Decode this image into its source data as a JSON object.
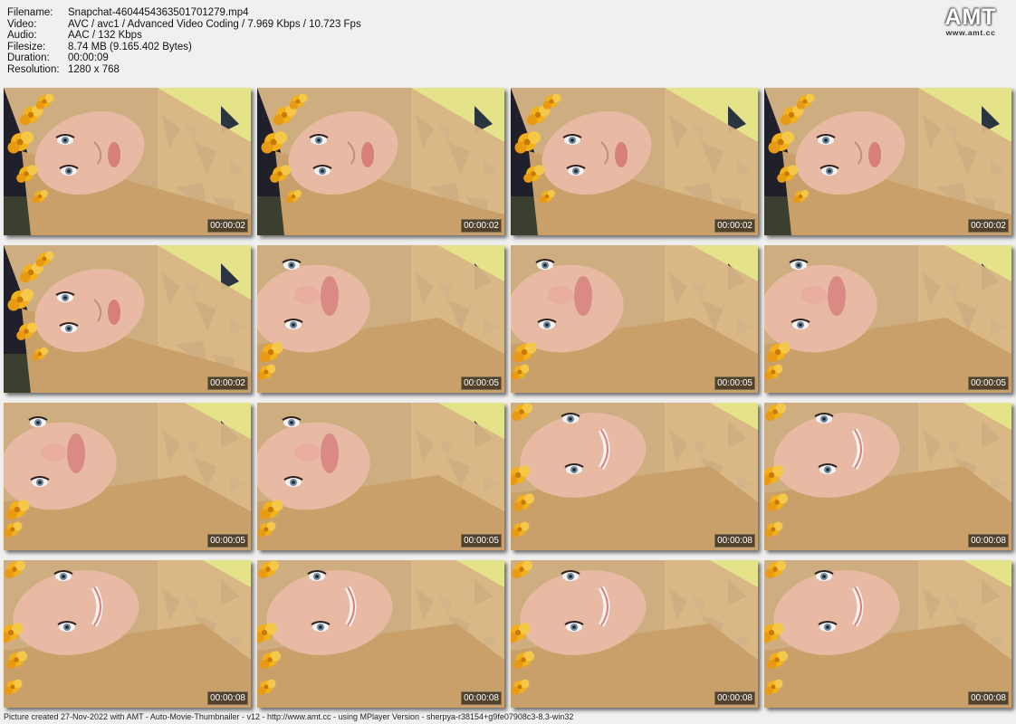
{
  "info": [
    {
      "label": "Filename:",
      "value": "Snapchat-4604454363501701279.mp4"
    },
    {
      "label": "Video:",
      "value": "AVC / avc1 / Advanced Video Coding / 7.969 Kbps / 10.723 Fps"
    },
    {
      "label": "Audio:",
      "value": "AAC / 132 Kbps"
    },
    {
      "label": "Filesize:",
      "value": "8.74 MB (9.165.402 Bytes)"
    },
    {
      "label": "Duration:",
      "value": "00:00:09"
    },
    {
      "label": "Resolution:",
      "value": "1280 x 768"
    }
  ],
  "logo": {
    "main": "AMT",
    "url": "www.amt.cc"
  },
  "thumbnails": [
    {
      "time": "00:00:02",
      "scene": "a"
    },
    {
      "time": "00:00:02",
      "scene": "a"
    },
    {
      "time": "00:00:02",
      "scene": "a"
    },
    {
      "time": "00:00:02",
      "scene": "a"
    },
    {
      "time": "00:00:02",
      "scene": "a"
    },
    {
      "time": "00:00:05",
      "scene": "b"
    },
    {
      "time": "00:00:05",
      "scene": "b"
    },
    {
      "time": "00:00:05",
      "scene": "b"
    },
    {
      "time": "00:00:05",
      "scene": "b"
    },
    {
      "time": "00:00:05",
      "scene": "b"
    },
    {
      "time": "00:00:08",
      "scene": "c"
    },
    {
      "time": "00:00:08",
      "scene": "c"
    },
    {
      "time": "00:00:08",
      "scene": "c"
    },
    {
      "time": "00:00:08",
      "scene": "c"
    },
    {
      "time": "00:00:08",
      "scene": "c"
    },
    {
      "time": "00:00:08",
      "scene": "c"
    }
  ],
  "colors": {
    "hair": "#d8b585",
    "skin": "#e8b9a3",
    "flowers": "#f2b01c",
    "pattern": "#e4e38a",
    "background": "#f0f0f0"
  },
  "footer": "Picture created 27-Nov-2022 with AMT - Auto-Movie-Thumbnailer - v12 - http://www.amt.cc - using MPlayer Version - sherpya-r38154+g9fe07908c3-8.3-win32"
}
